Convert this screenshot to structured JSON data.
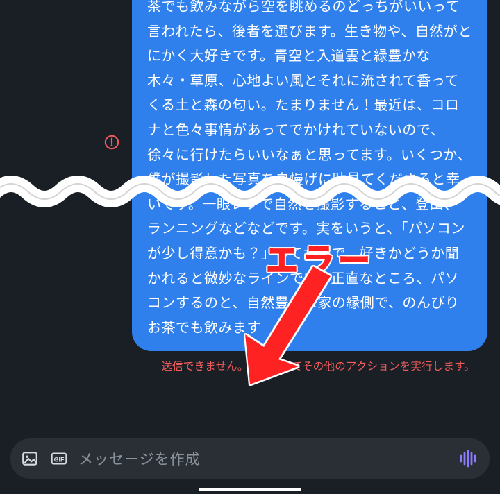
{
  "message": {
    "text": "茶でも飲みながら空を眺めるのどっちがいいって言われたら、後者を選びます。生き物や、自然がとにかく大好きです。青空と入道雲と緑豊かな木々・草原、心地よい風とそれに流されて香ってくる土と森の匂い。たまりません！最近は、コロナと色々事情があってでかけれていないので、徐々に行けたらいいなぁと思ってます。いくつか、僕が撮影した写真を自慢げに貼見てくださると幸いです。一眼レフで自然を撮影すること、登山、ランニングなどなどです。実をいうと、「パソコンが少し得意かも？」ってだけで、好きかどうか聞かれると微妙なラインです。正直なところ、パソコンするのと、自然豊かな家の縁側で、のんびりお茶でも飲みます",
    "error_text": "送信できません。タップしてその他のアクションを実行します。"
  },
  "composer": {
    "placeholder": "メッセージを作成"
  },
  "annotation": {
    "label": "エラー"
  },
  "icons": {
    "warning": "error-circle-icon",
    "image": "image-icon",
    "gif": "gif-icon",
    "voice": "voice-wave-icon"
  }
}
